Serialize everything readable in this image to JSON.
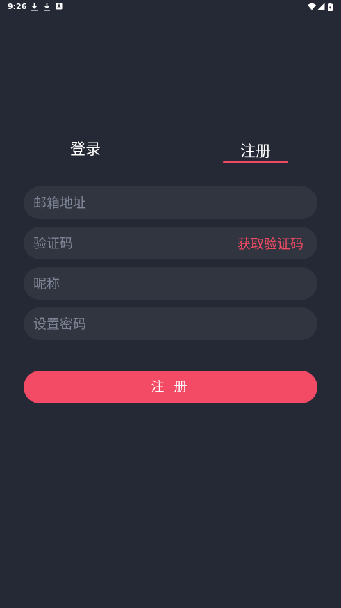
{
  "status_bar": {
    "time": "9:26",
    "icons": [
      "download-icon",
      "download-icon",
      "font-icon",
      "wifi-icon",
      "signal-icon",
      "battery-icon"
    ]
  },
  "tabs": {
    "login_label": "登录",
    "register_label": "注册",
    "active": "register",
    "accent_color": "#f04a64"
  },
  "form": {
    "email_placeholder": "邮箱地址",
    "code_placeholder": "验证码",
    "get_code_label": "获取验证码",
    "nickname_placeholder": "昵称",
    "password_placeholder": "设置密码",
    "submit_label": "注 册"
  },
  "colors": {
    "background": "#252936",
    "field": "#31353f",
    "accent": "#f34a65"
  }
}
